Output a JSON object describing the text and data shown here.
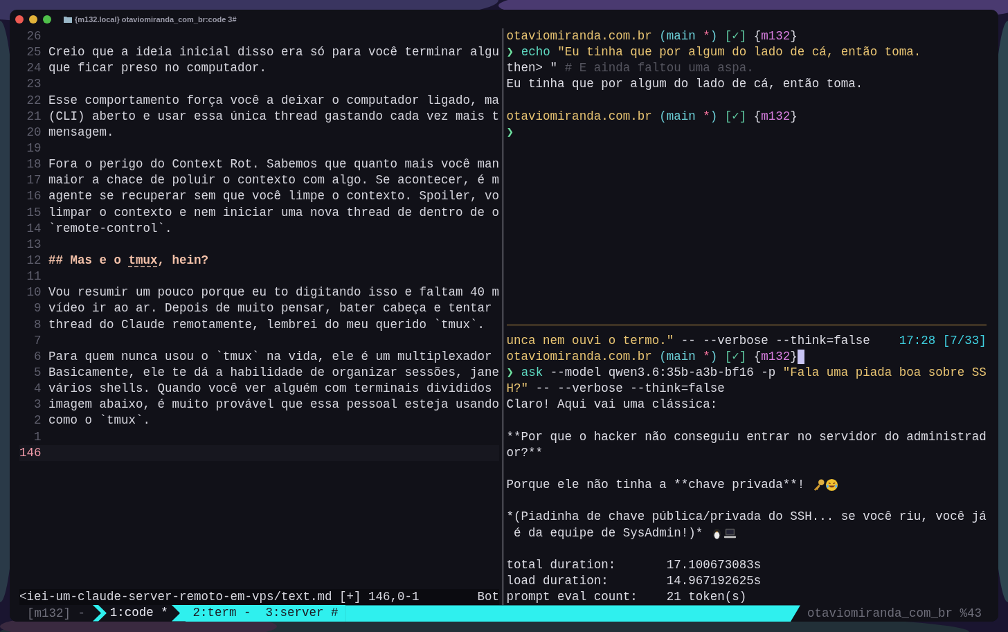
{
  "window": {
    "title": "{m132.local} otaviomiranda_com_br:code 3#"
  },
  "editor": {
    "lines": [
      {
        "number": "26"
      },
      {
        "number": "25",
        "text": "Creio que a ideia inicial disso era só para você terminar algu"
      },
      {
        "number": "24",
        "text": "que ficar preso no computador."
      },
      {
        "number": "23"
      },
      {
        "number": "22",
        "text": "Esse comportamento força você a deixar o computador ligado, ma"
      },
      {
        "number": "21",
        "text": "(CLI) aberto e usar essa única thread gastando cada vez mais t"
      },
      {
        "number": "20",
        "text": "mensagem."
      },
      {
        "number": "19"
      },
      {
        "number": "18",
        "text": "Fora o perigo do Context Rot. Sabemos que quanto mais você man"
      },
      {
        "number": "17",
        "text": "maior a chace de poluir o contexto com algo. Se acontecer, é m"
      },
      {
        "number": "16",
        "text": "agente se recuperar sem que você limpe o contexto. Spoiler, vo"
      },
      {
        "number": "15",
        "text": "limpar o contexto e nem iniciar uma nova thread de dentro de o"
      },
      {
        "number": "14",
        "text": "`remote-control`."
      },
      {
        "number": "13"
      },
      {
        "number": "12",
        "kind": "heading",
        "parts": [
          {
            "text": "## Mas e o ",
            "misspelled": false
          },
          {
            "text": "tmux",
            "misspelled": true
          },
          {
            "text": ", hein?",
            "misspelled": false
          }
        ]
      },
      {
        "number": "11"
      },
      {
        "number": "10",
        "text": "Vou resumir um pouco porque eu to digitando isso e faltam 40 m"
      },
      {
        "number": "9",
        "text": "vídeo ir ao ar. Depois de muito pensar, bater cabeça e tentar"
      },
      {
        "number": "8",
        "text": "thread do Claude remotamente, lembrei do meu querido `tmux`."
      },
      {
        "number": "7"
      },
      {
        "number": "6",
        "text": "Para quem nunca usou o `tmux` na vida, ele é um multiplexador"
      },
      {
        "number": "5",
        "text": "Basicamente, ele te dá a habilidade de organizar sessões, jane"
      },
      {
        "number": "4",
        "text": "vários shells. Quando você ver alguém com terminais divididos"
      },
      {
        "number": "3",
        "text": "imagem abaixo, é muito provável que essa pessoal esteja usando"
      },
      {
        "number": "2",
        "text": "como o `tmux`."
      },
      {
        "number": "1"
      }
    ],
    "cursor_line": {
      "number": "146"
    },
    "status": {
      "file": "<iei-um-claude-server-remoto-em-vps/text.md [+] 146,0-1",
      "position": "Bot"
    }
  },
  "top_pane": {
    "rows": [
      {
        "kind": "text",
        "segs": [
          {
            "kind": "path",
            "text": "otaviomiranda.com.br "
          },
          {
            "kind": "branch",
            "text": "(main "
          },
          {
            "kind": "dirty",
            "text": "*"
          },
          {
            "kind": "branch",
            "text": ") "
          },
          {
            "kind": "check",
            "text": "[✓] "
          },
          {
            "kind": "plain",
            "text": "{"
          },
          {
            "kind": "host",
            "text": "m132"
          },
          {
            "kind": "plain",
            "text": "}"
          }
        ]
      },
      {
        "kind": "text",
        "segs": [
          {
            "kind": "prompt",
            "text": "❯ "
          },
          {
            "kind": "cmd",
            "text": "echo "
          },
          {
            "kind": "str",
            "text": "\"Eu tinha que por algum do lado de cá, então toma."
          }
        ]
      },
      {
        "kind": "text",
        "segs": [
          {
            "kind": "plain",
            "text": "then> \" "
          },
          {
            "kind": "comment",
            "text": "# E ainda faltou uma aspa."
          }
        ]
      },
      {
        "kind": "text",
        "segs": [
          {
            "kind": "plain",
            "text": "Eu tinha que por algum do lado de cá, então toma."
          }
        ]
      },
      {
        "kind": "blank"
      },
      {
        "kind": "text",
        "segs": [
          {
            "kind": "path",
            "text": "otaviomiranda.com.br "
          },
          {
            "kind": "branch",
            "text": "(main "
          },
          {
            "kind": "dirty",
            "text": "*"
          },
          {
            "kind": "branch",
            "text": ") "
          },
          {
            "kind": "check",
            "text": "[✓] "
          },
          {
            "kind": "plain",
            "text": "{"
          },
          {
            "kind": "host",
            "text": "m132"
          },
          {
            "kind": "plain",
            "text": "}"
          }
        ]
      },
      {
        "kind": "text",
        "segs": [
          {
            "kind": "prompt",
            "text": "❯"
          }
        ]
      }
    ]
  },
  "bottom_pane": {
    "rows": [
      {
        "kind": "text",
        "indicator": "17:28 [7/33]",
        "segs": [
          {
            "kind": "str",
            "text": "unca nem ouvi o termo.\""
          },
          {
            "kind": "plain",
            "text": " -- --verbose --think=false"
          }
        ]
      },
      {
        "kind": "cursor",
        "segs": [
          {
            "kind": "path",
            "text": "otaviomiranda.com.br "
          },
          {
            "kind": "branch",
            "text": "(main "
          },
          {
            "kind": "dirty",
            "text": "*"
          },
          {
            "kind": "branch",
            "text": ") "
          },
          {
            "kind": "check",
            "text": "[✓] "
          },
          {
            "kind": "plain",
            "text": "{"
          },
          {
            "kind": "host",
            "text": "m132"
          },
          {
            "kind": "plain",
            "text": "}"
          }
        ]
      },
      {
        "kind": "text",
        "segs": [
          {
            "kind": "prompt",
            "text": "❯ "
          },
          {
            "kind": "cmd",
            "text": "ask"
          },
          {
            "kind": "plain",
            "text": " --model qwen3.6:35b-a3b-bf16 -p "
          },
          {
            "kind": "str",
            "text": "\"Fala uma piada boa sobre SS"
          }
        ]
      },
      {
        "kind": "text",
        "segs": [
          {
            "kind": "str",
            "text": "H?\""
          },
          {
            "kind": "plain",
            "text": " -- --verbose --think=false"
          }
        ]
      },
      {
        "kind": "text",
        "segs": [
          {
            "kind": "plain",
            "text": "Claro! Aqui vai uma clássica:"
          }
        ]
      },
      {
        "kind": "blank"
      },
      {
        "kind": "text",
        "segs": [
          {
            "kind": "plain",
            "text": "**Por que o hacker não conseguiu entrar no servidor do administrad"
          }
        ]
      },
      {
        "kind": "text",
        "segs": [
          {
            "kind": "plain",
            "text": "or?**"
          }
        ]
      },
      {
        "kind": "blank"
      },
      {
        "kind": "joke",
        "segs": [
          {
            "kind": "plain",
            "text": "Porque ele não tinha a **chave privada**!"
          }
        ]
      },
      {
        "kind": "blank"
      },
      {
        "kind": "text",
        "segs": [
          {
            "kind": "plain",
            "text": "*(Piadinha de chave pública/privada do SSH... se você riu, você já"
          }
        ]
      },
      {
        "kind": "aside",
        "segs": [
          {
            "kind": "plain",
            "text": " é da equipe de SysAdmin!)*"
          }
        ]
      },
      {
        "kind": "blank"
      },
      {
        "kind": "text",
        "segs": [
          {
            "kind": "plain",
            "text": "total duration:       17.100673083s"
          }
        ]
      },
      {
        "kind": "text",
        "segs": [
          {
            "kind": "plain",
            "text": "load duration:        14.967192625s"
          }
        ]
      },
      {
        "kind": "text",
        "segs": [
          {
            "kind": "plain",
            "text": "prompt eval count:    21 token(s)"
          }
        ]
      }
    ]
  },
  "tmux_bar": {
    "session": "[m132] -",
    "windows": [
      {
        "label": "1:code *",
        "selected": true
      },
      {
        "label": "2:term -",
        "selected": false
      },
      {
        "label": "3:server #",
        "selected": false
      }
    ],
    "right": "otaviomiranda_com_br %43"
  }
}
